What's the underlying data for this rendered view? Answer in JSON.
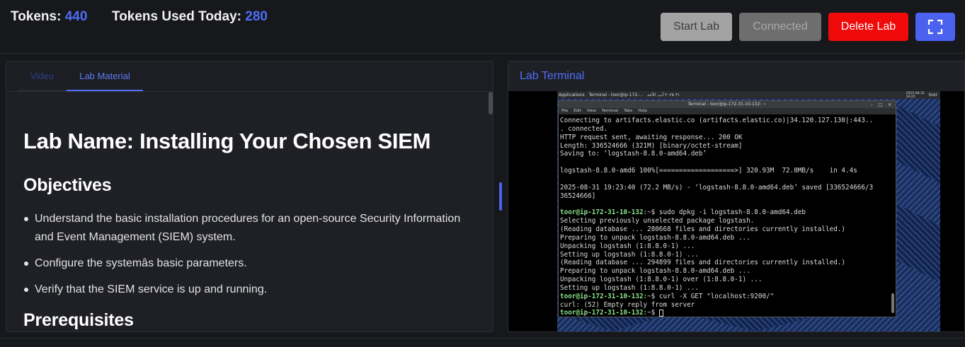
{
  "header": {
    "tokens_label": "Tokens:",
    "tokens_value": "440",
    "used_label": "Tokens Used Today:",
    "used_value": "280"
  },
  "buttons": {
    "start": "Start Lab",
    "connected": "Connected",
    "delete": "Delete Lab",
    "fullscreen_icon": "fullscreen-icon"
  },
  "tabs": {
    "video": "Video",
    "lab_material": "Lab Material",
    "active": "Lab Material"
  },
  "material": {
    "title": "Lab Name: Installing Your Chosen SIEM",
    "objectives_heading": "Objectives",
    "objectives": [
      "Understand the basic installation procedures for an open-source Security Information and Event Management (SIEM) system.",
      "Configure the systemâs basic parameters.",
      "Verify that the SIEM service is up and running."
    ],
    "prereq_heading": "Prerequisites"
  },
  "terminal_panel": {
    "title": "Lab Terminal"
  },
  "desktop": {
    "taskbar": {
      "applications": "Applications",
      "terminal_task": "Terminal - toor@ip-172-...",
      "rtl_text": "٣١ ٢٠٢٥ آب, الأحد",
      "clock": "2025-08-31\n19:25",
      "user": "toor"
    },
    "window": {
      "title": "Terminal - toor@ip-172-31-10-132: ~",
      "menu": [
        "File",
        "Edit",
        "View",
        "Terminal",
        "Tabs",
        "Help"
      ]
    },
    "terminal_lines": [
      {
        "t": "Connecting to artifacts.elastic.co (artifacts.elastic.co)|34.120.127.130|:443.."
      },
      {
        "t": ". connected."
      },
      {
        "t": "HTTP request sent, awaiting response... 200 OK"
      },
      {
        "t": "Length: 336524666 (321M) [binary/octet-stream]"
      },
      {
        "t": "Saving to: ‘logstash-8.8.0-amd64.deb’"
      },
      {
        "t": ""
      },
      {
        "t": "logstash-8.8.0-amd6 100%[===================>] 320.93M  72.0MB/s    in 4.4s"
      },
      {
        "t": ""
      },
      {
        "t": "2025-08-31 19:23:40 (72.2 MB/s) - ‘logstash-8.8.0-amd64.deb’ saved [336524666/3"
      },
      {
        "t": "36524666]"
      },
      {
        "t": ""
      },
      {
        "p": "toor@ip-172-31-10-132",
        "t": ":~$ sudo dpkg -i logstash-8.8.0-amd64.deb"
      },
      {
        "t": "Selecting previously unselected package logstash."
      },
      {
        "t": "(Reading database ... 280668 files and directories currently installed.)"
      },
      {
        "t": "Preparing to unpack logstash-8.8.0-amd64.deb ..."
      },
      {
        "t": "Unpacking logstash (1:8.8.0-1) ..."
      },
      {
        "t": "Setting up logstash (1:8.8.0-1) ..."
      },
      {
        "t": "(Reading database ... 294899 files and directories currently installed.)"
      },
      {
        "t": "Preparing to unpack logstash-8.8.0-amd64.deb ..."
      },
      {
        "t": "Unpacking logstash (1:8.8.0-1) over (1:8.8.0-1) ..."
      },
      {
        "t": "Setting up logstash (1:8.8.0-1) ..."
      },
      {
        "p": "toor@ip-172-31-10-132",
        "t": ":~$ curl -X GET \"localhost:9200/\""
      },
      {
        "t": "curl: (52) Empty reply from server"
      },
      {
        "p": "toor@ip-172-31-10-132",
        "t": ":~$ ",
        "cursor": true
      }
    ]
  },
  "colors": {
    "accent": "#4d6ef5",
    "delete": "#f00a0a",
    "prompt": "#8be28b",
    "background": "#17181c",
    "panel": "#1f2026"
  }
}
